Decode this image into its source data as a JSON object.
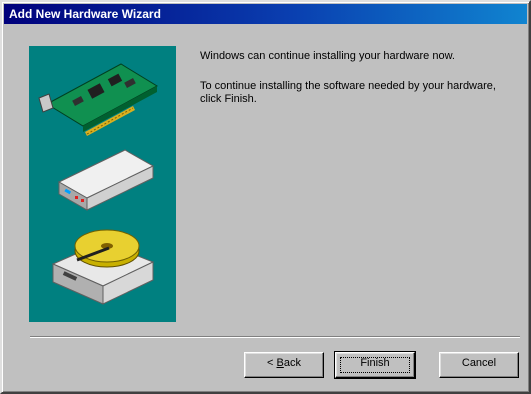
{
  "window": {
    "title": "Add New Hardware Wizard"
  },
  "content": {
    "line1": "Windows can continue installing your hardware now.",
    "line2": "To continue installing the software needed by your hardware, click Finish."
  },
  "buttons": {
    "back_prefix": "< ",
    "back_accel": "B",
    "back_rest": "ack",
    "finish": "Finish",
    "cancel": "Cancel"
  },
  "art": {
    "background": "#008080",
    "icons": [
      "expansion-card-icon",
      "modem-icon",
      "disk-drive-icon"
    ]
  }
}
